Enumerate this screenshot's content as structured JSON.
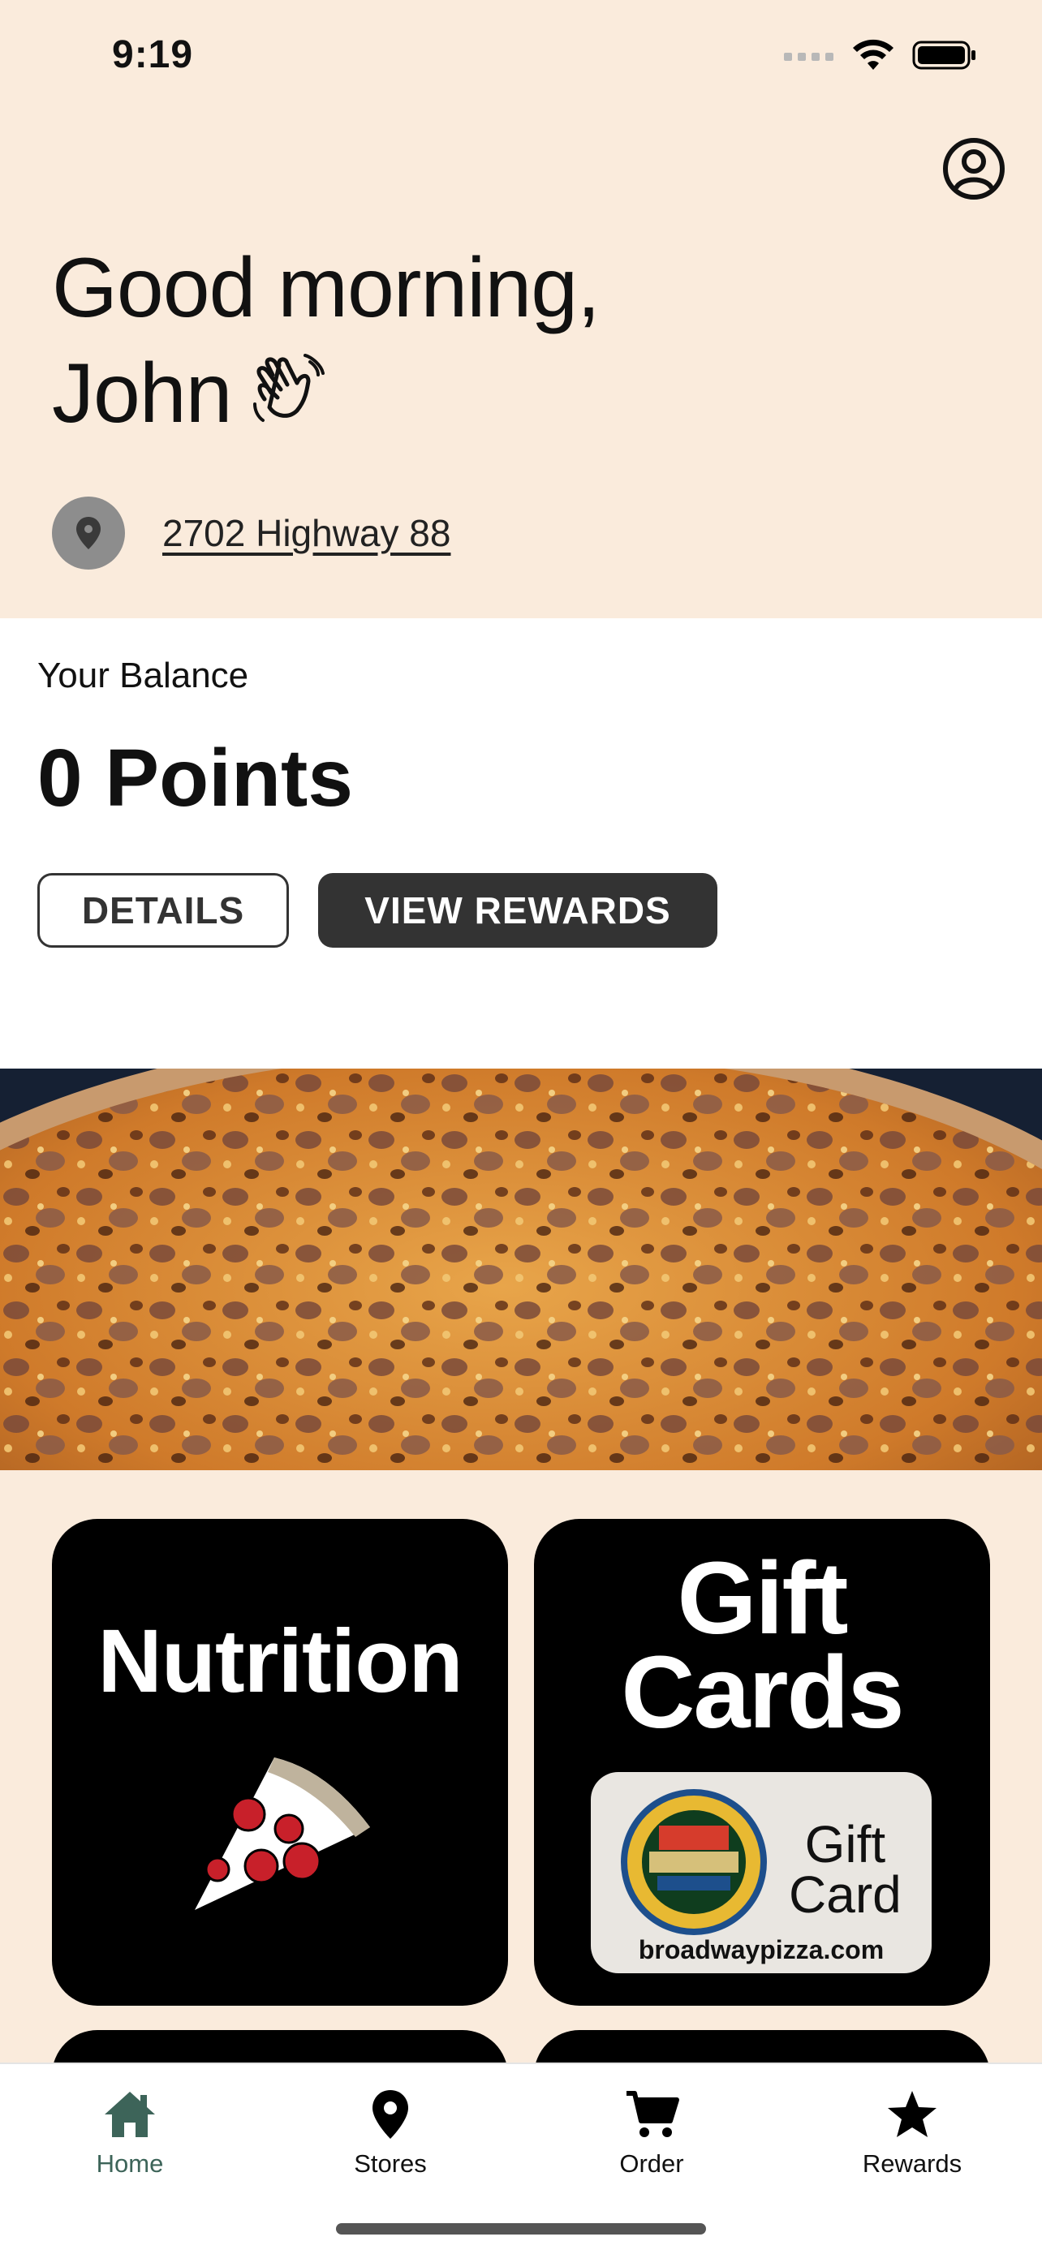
{
  "status_bar": {
    "time": "9:19"
  },
  "header": {
    "greeting_line1": "Good morning,",
    "greeting_line2": "John",
    "location": "2702 Highway 88"
  },
  "balance": {
    "label": "Your Balance",
    "points": "0 Points",
    "details_button": "DETAILS",
    "view_rewards_button": "VIEW REWARDS"
  },
  "tiles": [
    {
      "title": "Nutrition"
    },
    {
      "title_line1": "Gift",
      "title_line2": "Cards",
      "card_word_line1": "Gift",
      "card_word_line2": "Card",
      "card_url": "broadwaypizza.com"
    }
  ],
  "tabbar": {
    "items": [
      {
        "label": "Home",
        "icon": "home-icon",
        "active": true
      },
      {
        "label": "Stores",
        "icon": "map-pin-icon",
        "active": false
      },
      {
        "label": "Order",
        "icon": "cart-icon",
        "active": false
      },
      {
        "label": "Rewards",
        "icon": "star-icon",
        "active": false
      }
    ]
  },
  "colors": {
    "header_bg": "#faebdc",
    "active_tab": "#3d6459",
    "button_dark": "#333333"
  }
}
